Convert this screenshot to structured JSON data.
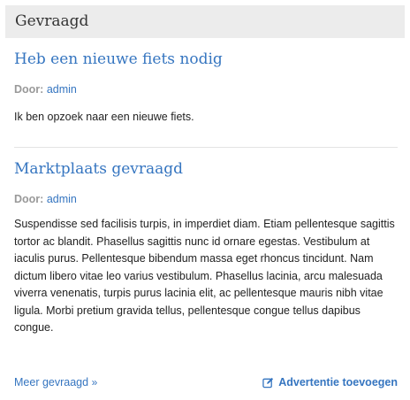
{
  "widget": {
    "title": "Gevraagd"
  },
  "posts": [
    {
      "title": "Heb een nieuwe fiets nodig",
      "meta_label": "Door:",
      "author": "admin",
      "body": "Ik ben opzoek naar een nieuwe fiets."
    },
    {
      "title": "Marktplaats gevraagd",
      "meta_label": "Door:",
      "author": "admin",
      "body": "Suspendisse sed facilisis turpis, in imperdiet diam. Etiam pellentesque sagittis tortor ac blandit. Phasellus sagittis nunc id ornare egestas. Vestibulum at iaculis purus. Pellentesque bibendum massa eget rhoncus tincidunt. Nam dictum libero vitae leo varius vestibulum. Phasellus lacinia, arcu malesuada viverra venenatis, turpis purus lacinia elit, ac pellentesque mauris nibh vitae ligula. Morbi pretium gravida tellus, pellentesque congue tellus dapibus congue."
    }
  ],
  "footer": {
    "more_label": "Meer gevraagd",
    "more_icon": "double-chevron-right-icon",
    "add_label": "Advertentie toevoegen",
    "add_icon": "edit-icon"
  },
  "colors": {
    "link": "#3575c0",
    "header_bg": "#ececec",
    "meta": "#999999"
  }
}
